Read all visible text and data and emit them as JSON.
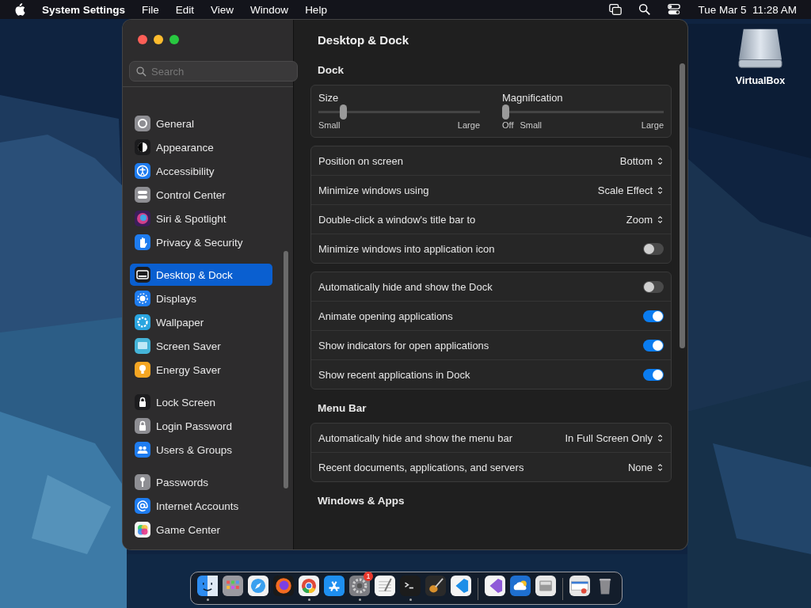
{
  "menu_bar": {
    "app": "System Settings",
    "menus": [
      "File",
      "Edit",
      "View",
      "Window",
      "Help"
    ],
    "clock": "Tue Mar 5  11:28 AM"
  },
  "desktop_icons": [
    {
      "label": "VirtualBox"
    }
  ],
  "window": {
    "title": "Desktop & Dock",
    "search": {
      "placeholder": "Search"
    },
    "sidebar": {
      "groups": [
        {
          "items": [
            {
              "label": "General",
              "selected": false
            },
            {
              "label": "Appearance",
              "selected": false
            },
            {
              "label": "Accessibility",
              "selected": false
            },
            {
              "label": "Control Center",
              "selected": false
            },
            {
              "label": "Siri & Spotlight",
              "selected": false
            },
            {
              "label": "Privacy & Security",
              "selected": false
            }
          ]
        },
        {
          "items": [
            {
              "label": "Desktop & Dock",
              "selected": true
            },
            {
              "label": "Displays",
              "selected": false
            },
            {
              "label": "Wallpaper",
              "selected": false
            },
            {
              "label": "Screen Saver",
              "selected": false
            },
            {
              "label": "Energy Saver",
              "selected": false
            }
          ]
        },
        {
          "items": [
            {
              "label": "Lock Screen",
              "selected": false
            },
            {
              "label": "Login Password",
              "selected": false
            },
            {
              "label": "Users & Groups",
              "selected": false
            }
          ]
        },
        {
          "items": [
            {
              "label": "Passwords",
              "selected": false
            },
            {
              "label": "Internet Accounts",
              "selected": false
            },
            {
              "label": "Game Center",
              "selected": false
            }
          ]
        }
      ]
    },
    "sections": [
      {
        "heading": "Dock",
        "cards": [
          {
            "kind": "sliders",
            "sliders": [
              {
                "label": "Size",
                "level": 0.14,
                "min_label": "Small",
                "max_label": "Large"
              },
              {
                "label": "Magnification",
                "level": 0,
                "off_label": "Off",
                "min_label": "Small",
                "max_label": "Large"
              }
            ]
          },
          {
            "kind": "rows",
            "rows": [
              {
                "kind": "popup",
                "label": "Position on screen",
                "value": "Bottom"
              },
              {
                "kind": "popup",
                "label": "Minimize windows using",
                "value": "Scale Effect"
              },
              {
                "kind": "popup",
                "label": "Double-click a window's title bar to",
                "value": "Zoom"
              },
              {
                "kind": "toggle",
                "label": "Minimize windows into application icon",
                "on": false
              }
            ]
          },
          {
            "kind": "rows",
            "rows": [
              {
                "kind": "toggle",
                "label": "Automatically hide and show the Dock",
                "on": false
              },
              {
                "kind": "toggle",
                "label": "Animate opening applications",
                "on": true
              },
              {
                "kind": "toggle",
                "label": "Show indicators for open applications",
                "on": true
              },
              {
                "kind": "toggle",
                "label": "Show recent applications in Dock",
                "on": true
              }
            ]
          }
        ]
      },
      {
        "heading": "Menu Bar",
        "cards": [
          {
            "kind": "rows",
            "rows": [
              {
                "kind": "popup",
                "label": "Automatically hide and show the menu bar",
                "value": "In Full Screen Only"
              },
              {
                "kind": "popup",
                "label": "Recent documents, applications, and servers",
                "value": "None"
              }
            ]
          }
        ]
      },
      {
        "heading": "Windows & Apps"
      }
    ]
  },
  "dock": {
    "items": [
      {
        "kind": "app",
        "running": true
      },
      {
        "kind": "app",
        "running": false
      },
      {
        "kind": "app",
        "running": false
      },
      {
        "kind": "app",
        "running": false
      },
      {
        "kind": "app",
        "running": true
      },
      {
        "kind": "app",
        "running": false
      },
      {
        "kind": "app",
        "running": true,
        "badge": "1"
      },
      {
        "kind": "app",
        "running": false
      },
      {
        "kind": "app",
        "running": true
      },
      {
        "kind": "app",
        "running": false
      },
      {
        "kind": "app",
        "running": false
      },
      {
        "kind": "separator"
      },
      {
        "kind": "app",
        "running": false
      },
      {
        "kind": "app",
        "running": false
      },
      {
        "kind": "app",
        "running": false
      },
      {
        "kind": "separator"
      },
      {
        "kind": "app",
        "running": false
      },
      {
        "kind": "app",
        "running": false
      }
    ]
  }
}
